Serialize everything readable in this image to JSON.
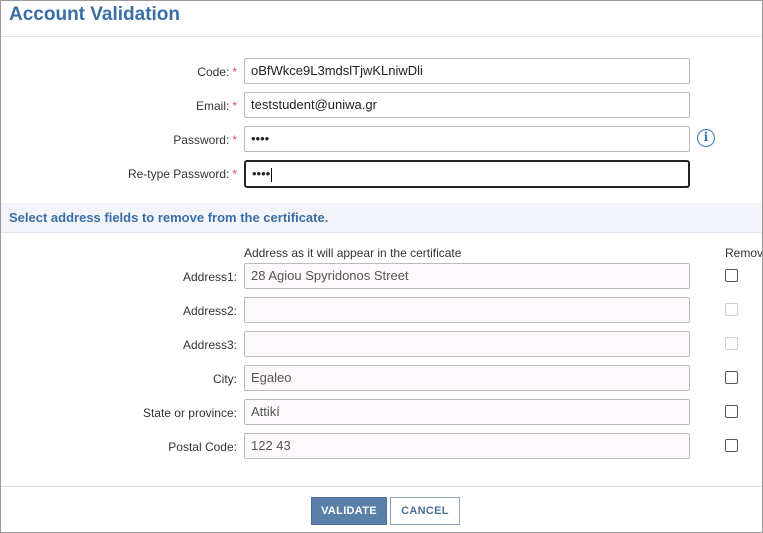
{
  "title": "Account Validation",
  "form": {
    "code": {
      "label": "Code:",
      "value": "oBfWkce9L3mdslTjwKLniwDli"
    },
    "email": {
      "label": "Email:",
      "value": "teststudent@uniwa.gr"
    },
    "password": {
      "label": "Password:",
      "value": "••••"
    },
    "retype_password": {
      "label": "Re-type Password:",
      "value": "••••"
    },
    "required_mark": "*"
  },
  "address_section": {
    "heading": "Select address fields to remove from the certificate.",
    "column_address": "Address as it will appear in the certificate",
    "column_remove": "Remove",
    "fields": [
      {
        "label": "Address1:",
        "value": "28 Agiou Spyridonos Street",
        "remove_enabled": true
      },
      {
        "label": "Address2:",
        "value": "",
        "remove_enabled": false
      },
      {
        "label": "Address3:",
        "value": "",
        "remove_enabled": false
      },
      {
        "label": "City:",
        "value": "Egaleo",
        "remove_enabled": true
      },
      {
        "label": "State or province:",
        "value": "Attikí",
        "remove_enabled": true
      },
      {
        "label": "Postal Code:",
        "value": "122 43",
        "remove_enabled": true
      }
    ]
  },
  "buttons": {
    "validate": "VALIDATE",
    "cancel": "CANCEL"
  },
  "icons": {
    "password_help": "info-icon"
  },
  "colors": {
    "accent": "#3a6ea5",
    "required": "#d9534f",
    "primary_button": "#5a7fa8"
  }
}
